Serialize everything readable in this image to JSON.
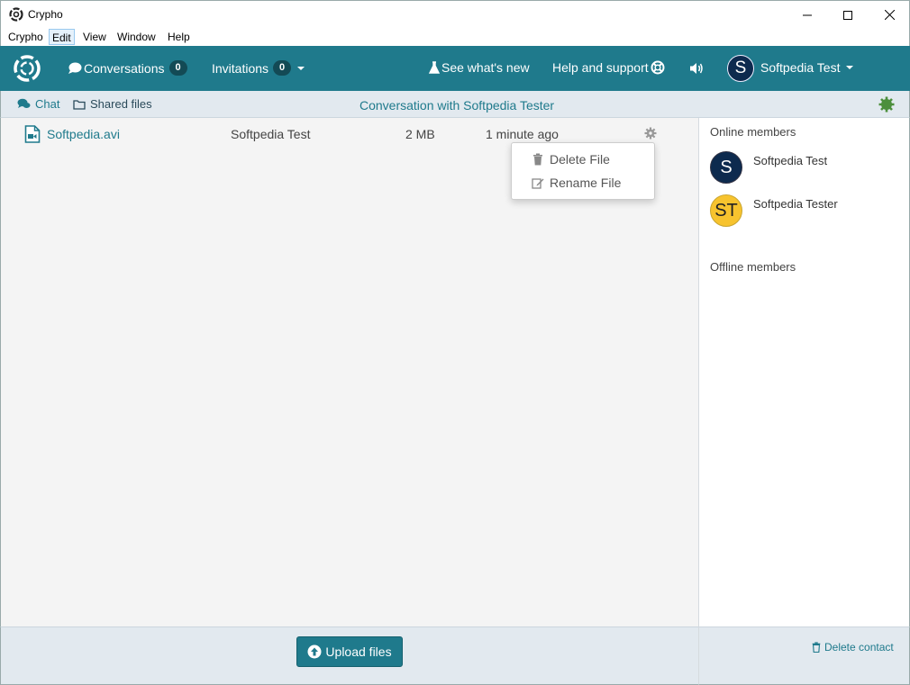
{
  "window": {
    "title": "Crypho"
  },
  "menu": [
    "Crypho",
    "Edit",
    "View",
    "Window",
    "Help"
  ],
  "nav": {
    "conversations_label": "Conversations",
    "conversations_count": "0",
    "invitations_label": "Invitations",
    "invitations_count": "0",
    "whats_new": "See what's new",
    "help": "Help and support",
    "user_initial": "S",
    "user_name": "Softpedia Test"
  },
  "subnav": {
    "chat": "Chat",
    "shared_files": "Shared files",
    "conversation_title": "Conversation with Softpedia Tester"
  },
  "files": [
    {
      "name": "Softpedia.avi",
      "owner": "Softpedia Test",
      "size": "2 MB",
      "time": "1 minute ago"
    }
  ],
  "file_menu": {
    "delete": "Delete File",
    "rename": "Rename File"
  },
  "members": {
    "online_heading": "Online members",
    "offline_heading": "Offline members",
    "online": [
      {
        "initials": "S",
        "name": "Softpedia Test",
        "color": "#0d2a4e",
        "text_color": "#ffffff"
      },
      {
        "initials": "ST",
        "name": "Softpedia Tester",
        "color": "#f7c32e",
        "text_color": "#222222"
      }
    ]
  },
  "actions": {
    "upload": "Upload files",
    "delete_contact": "Delete contact"
  },
  "colors": {
    "brand": "#1f7a8c",
    "status_online": "#4c8f3c"
  }
}
